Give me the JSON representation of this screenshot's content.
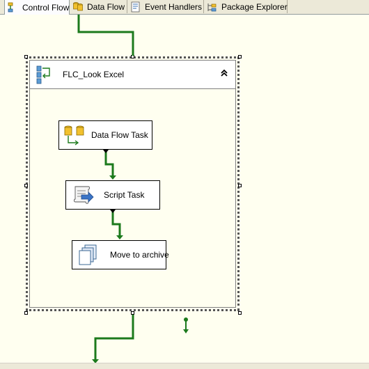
{
  "tabs": [
    {
      "label": "Control Flow",
      "icon": "control-flow-icon",
      "active": true
    },
    {
      "label": "Data Flow",
      "icon": "data-flow-icon",
      "active": false
    },
    {
      "label": "Event Handlers",
      "icon": "event-handlers-icon",
      "active": false
    },
    {
      "label": "Package Explorer",
      "icon": "package-explorer-icon",
      "active": false
    }
  ],
  "container": {
    "title": "FLC_Look Excel",
    "icon": "foreach-loop-container-icon",
    "collapse_icon": "collapse-chevron-up-icon"
  },
  "tasks": [
    {
      "label": "Data Flow Task",
      "icon": "data-flow-task-icon"
    },
    {
      "label": "Script Task",
      "icon": "script-task-icon"
    },
    {
      "label": "Move to archive",
      "icon": "file-system-task-icon"
    }
  ],
  "colors": {
    "canvas": "#fffff0",
    "precedence_success": "#1c7a1c",
    "tab_strip": "#ece9d8"
  }
}
